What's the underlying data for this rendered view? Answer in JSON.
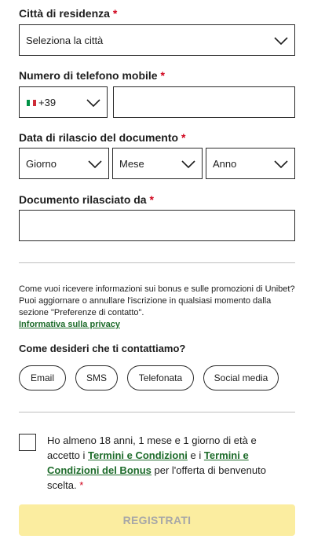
{
  "colors": {
    "required": "#d0021b",
    "link": "#1d6b2a",
    "register_bg": "#fbeda0",
    "register_text": "#a7a7a7",
    "border": "#2b2b2b"
  },
  "city": {
    "label": "Città di residenza",
    "required": "*",
    "selected": "Seleziona la città"
  },
  "phone": {
    "label": "Numero di telefono mobile",
    "required": "*",
    "country_code": "+39",
    "flag_icon": "italy-flag-icon",
    "number_value": ""
  },
  "issue_date": {
    "label": "Data di rilascio del documento",
    "required": "*",
    "day": "Giorno",
    "month": "Mese",
    "year": "Anno"
  },
  "issuer": {
    "label": "Documento rilasciato da",
    "required": "*",
    "value": ""
  },
  "marketing": {
    "info": "Come vuoi ricevere informazioni sui bonus e sulle promozioni di Unibet? Puoi aggiornare o annullare l'iscrizione in qualsiasi momento dalla sezione \"Preferenze di contatto\".",
    "privacy_link": "Informativa sulla privacy",
    "contact_question": "Come desideri che ti contattiamo?",
    "options": [
      "Email",
      "SMS",
      "Telefonata",
      "Social media"
    ]
  },
  "consent": {
    "text_1": "Ho almeno 18 anni, 1 mese e 1 giorno di età e accetto i ",
    "link_1": "Termini e Condizioni",
    "text_2": " e i ",
    "link_2": "Termini e Condizioni del Bonus",
    "text_3": " per l'offerta di benvenuto scelta. ",
    "required": "*"
  },
  "register_label": "REGISTRATI"
}
